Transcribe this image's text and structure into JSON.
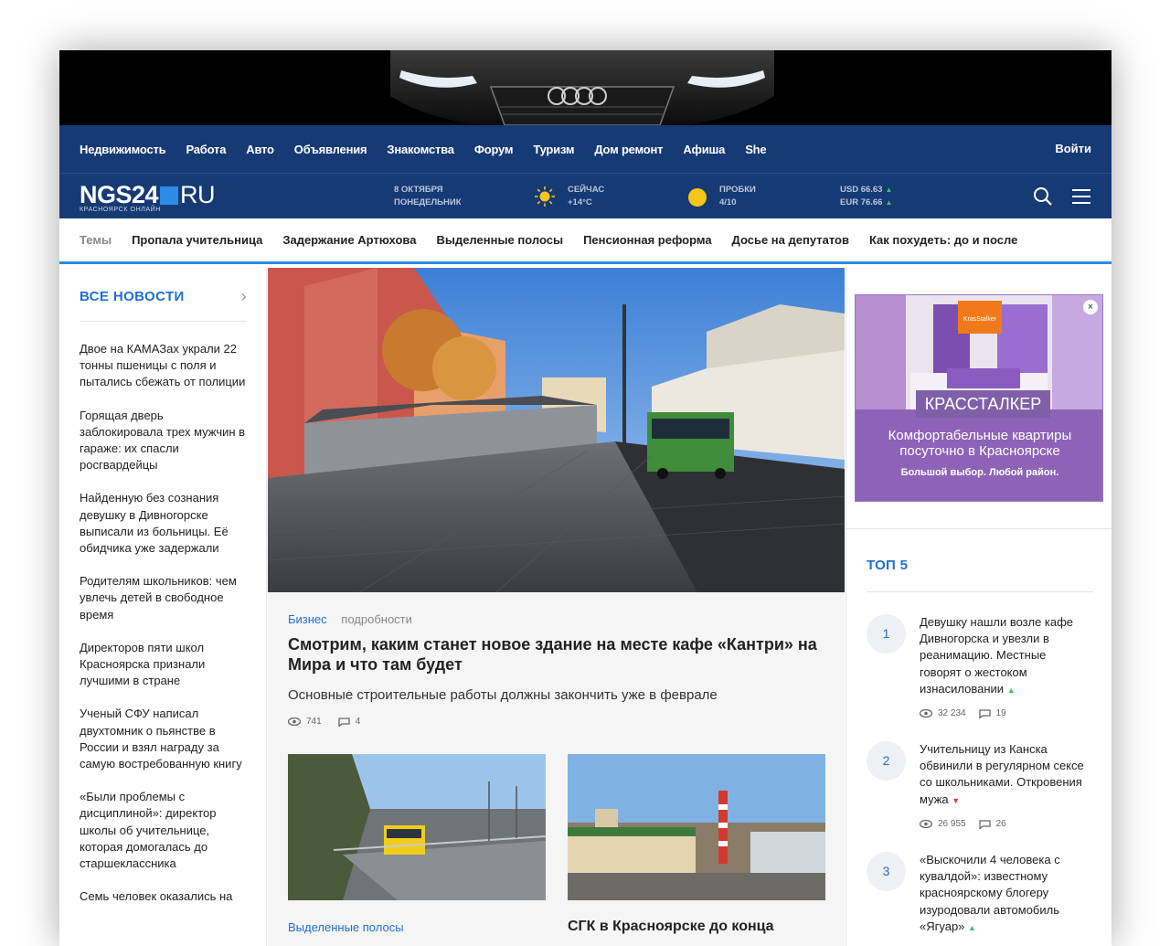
{
  "nav": {
    "items": [
      "Недвижимость",
      "Работа",
      "Авто",
      "Объявления",
      "Знакомства",
      "Форум",
      "Туризм",
      "Дом ремонт",
      "Афиша",
      "She"
    ],
    "login": "Войти"
  },
  "header": {
    "logo": {
      "main": "NGS24",
      "ru": "RU",
      "sub": "КРАСНОЯРСК ОНЛАЙН"
    },
    "date": {
      "line1": "8 ОКТЯБРЯ",
      "line2": "ПОНЕДЕЛЬНИК"
    },
    "weather": {
      "line1": "СЕЙЧАС",
      "line2": "+14°C"
    },
    "traffic": {
      "line1": "ПРОБКИ",
      "line2": "4/10"
    },
    "rates": {
      "usd": "USD 66.63",
      "eur": "EUR 76.66"
    },
    "icons": {
      "search": "search-icon",
      "menu": "hamburger-icon",
      "weather": "sun-icon",
      "traffic": "traffic-icon"
    }
  },
  "topics": {
    "label": "Темы",
    "items": [
      "Пропала учительница",
      "Задержание Артюхова",
      "Выделенные полосы",
      "Пенсионная реформа",
      "Досье на депутатов",
      "Как похудеть: до и после"
    ]
  },
  "left": {
    "all_news": "ВСЕ НОВОСТИ",
    "news": [
      "Двое на КАМАЗах украли 22 тонны пшеницы с поля и пытались сбежать от полиции",
      "Горящая дверь заблокировала трех мужчин в гараже: их спасли росгвардейцы",
      "Найденную без сознания девушку в Дивногорске выписали из больницы. Её обидчика уже задержали",
      "Родителям школьников: чем увлечь детей в свободное время",
      "Директоров пяти школ Красноярска признали лучшими в стране",
      "Ученый СФУ написал двухтомник о пьянстве в России и взял награду за самую востребованную книгу",
      "«Были проблемы с дисциплиной»: директор школы об учительнице, которая домогалась до старшеклассника",
      "Семь человек оказались на"
    ]
  },
  "main": {
    "category": "Бизнес",
    "details": "подробности",
    "headline": "Смотрим, каким станет новое здание на месте кафе «Кантри» на Мира и что там будет",
    "lead": "Основные строительные работы должны закончить уже в феврале",
    "views": "741",
    "comments": "4",
    "card1_caption": "Выделенные полосы",
    "card2_caption": "СГК в Красноярске до конца"
  },
  "ad": {
    "brand": "КРАССТАЛКЕР",
    "line1": "Комфортабельные квартиры посуточно в Красноярске",
    "line2": "Большой выбор. Любой район.",
    "logo_text": "KrasStalker",
    "close": "×"
  },
  "top5": {
    "title": "ТОП 5",
    "items": [
      {
        "num": "1",
        "text": "Девушку нашли возле кафе Дивногорска и увезли в реанимацию. Местные говорят о жестоком изнасиловании",
        "trend": "▲",
        "views": "32 234",
        "comments": "19"
      },
      {
        "num": "2",
        "text": "Учительницу из Канска обвинили в регулярном сексе со школьниками. Откровения мужа",
        "trend": "▼",
        "views": "26 955",
        "comments": "26"
      },
      {
        "num": "3",
        "text": "«Выскочили 4 человека с кувалдой»: известному красноярскому блогеру изуродовали автомобиль «Ягуар»",
        "trend": "▲"
      }
    ]
  }
}
